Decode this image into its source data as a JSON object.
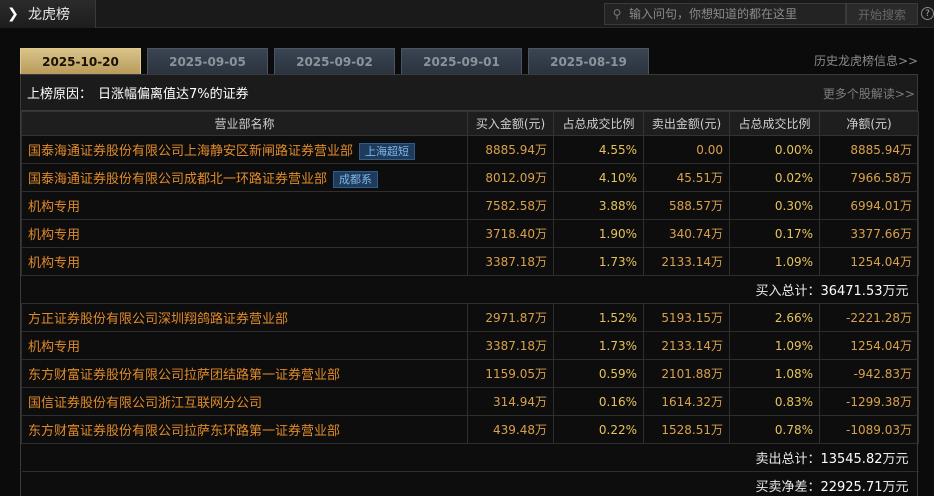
{
  "titlebar": {
    "title": "龙虎榜",
    "search_placeholder": "输入问句，你想知道的都在这里",
    "search_button": "开始搜索",
    "help": "?"
  },
  "tabs": [
    "2025-10-20",
    "2025-09-05",
    "2025-09-02",
    "2025-09-01",
    "2025-08-19"
  ],
  "active_tab": 0,
  "history_link": "历史龙虎榜信息>>",
  "reason": {
    "label": "上榜原因：",
    "text": "日涨幅偏离值达7%的证券"
  },
  "more_link": "更多个股解读>>",
  "columns": [
    "营业部名称",
    "买入金额(元)",
    "占总成交比例",
    "卖出金额(元)",
    "占总成交比例",
    "净额(元)"
  ],
  "buy_rows": [
    {
      "name": "国泰海通证券股份有限公司上海静安区新闸路证券营业部",
      "tag": "上海超短",
      "buy": "8885.94万",
      "buy_pct": "4.55%",
      "sell": "0.00",
      "sell_pct": "0.00%",
      "net": "8885.94万"
    },
    {
      "name": "国泰海通证券股份有限公司成都北一环路证券营业部",
      "tag": "成都系",
      "buy": "8012.09万",
      "buy_pct": "4.10%",
      "sell": "45.51万",
      "sell_pct": "0.02%",
      "net": "7966.58万"
    },
    {
      "name": "机构专用",
      "tag": "",
      "buy": "7582.58万",
      "buy_pct": "3.88%",
      "sell": "588.57万",
      "sell_pct": "0.30%",
      "net": "6994.01万"
    },
    {
      "name": "机构专用",
      "tag": "",
      "buy": "3718.40万",
      "buy_pct": "1.90%",
      "sell": "340.74万",
      "sell_pct": "0.17%",
      "net": "3377.66万"
    },
    {
      "name": "机构专用",
      "tag": "",
      "buy": "3387.18万",
      "buy_pct": "1.73%",
      "sell": "2133.14万",
      "sell_pct": "1.09%",
      "net": "1254.04万"
    }
  ],
  "buy_total": {
    "label": "买入总计：",
    "value": "36471.53",
    "unit": "万元"
  },
  "sell_rows": [
    {
      "name": "方正证券股份有限公司深圳翔鸽路证券营业部",
      "tag": "",
      "buy": "2971.87万",
      "buy_pct": "1.52%",
      "sell": "5193.15万",
      "sell_pct": "2.66%",
      "net": "-2221.28万"
    },
    {
      "name": "机构专用",
      "tag": "",
      "buy": "3387.18万",
      "buy_pct": "1.73%",
      "sell": "2133.14万",
      "sell_pct": "1.09%",
      "net": "1254.04万"
    },
    {
      "name": "东方财富证券股份有限公司拉萨团结路第一证券营业部",
      "tag": "",
      "buy": "1159.05万",
      "buy_pct": "0.59%",
      "sell": "2101.88万",
      "sell_pct": "1.08%",
      "net": "-942.83万"
    },
    {
      "name": "国信证券股份有限公司浙江互联网分公司",
      "tag": "",
      "buy": "314.94万",
      "buy_pct": "0.16%",
      "sell": "1614.32万",
      "sell_pct": "0.83%",
      "net": "-1299.38万"
    },
    {
      "name": "东方财富证券股份有限公司拉萨东环路第一证券营业部",
      "tag": "",
      "buy": "439.48万",
      "buy_pct": "0.22%",
      "sell": "1528.51万",
      "sell_pct": "0.78%",
      "net": "-1089.03万"
    }
  ],
  "sell_total": {
    "label": "卖出总计：",
    "value": "13545.82",
    "unit": "万元"
  },
  "net_total": {
    "label": "买卖净差：",
    "value": "22925.71",
    "unit": "万元"
  }
}
